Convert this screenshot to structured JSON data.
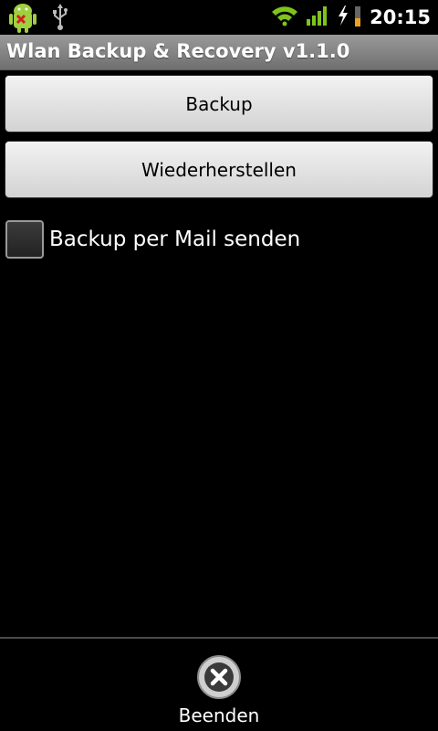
{
  "status_bar": {
    "time": "20:15",
    "icons": [
      "android-debug-icon",
      "usb-icon",
      "wifi-icon",
      "signal-icon",
      "charging-icon",
      "battery-icon"
    ]
  },
  "app": {
    "title": "Wlan Backup & Recovery v1.1.0"
  },
  "actions": {
    "backup_label": "Backup",
    "restore_label": "Wiederherstellen"
  },
  "options": {
    "mail_label": "Backup per Mail senden",
    "mail_checked": false
  },
  "footer": {
    "exit_label": "Beenden"
  },
  "colors": {
    "background": "#000000",
    "title_bar": "#7f7f7f",
    "button": "#e2e2e2",
    "signal_green": "#7fc31c",
    "battery_orange": "#f0a020"
  }
}
